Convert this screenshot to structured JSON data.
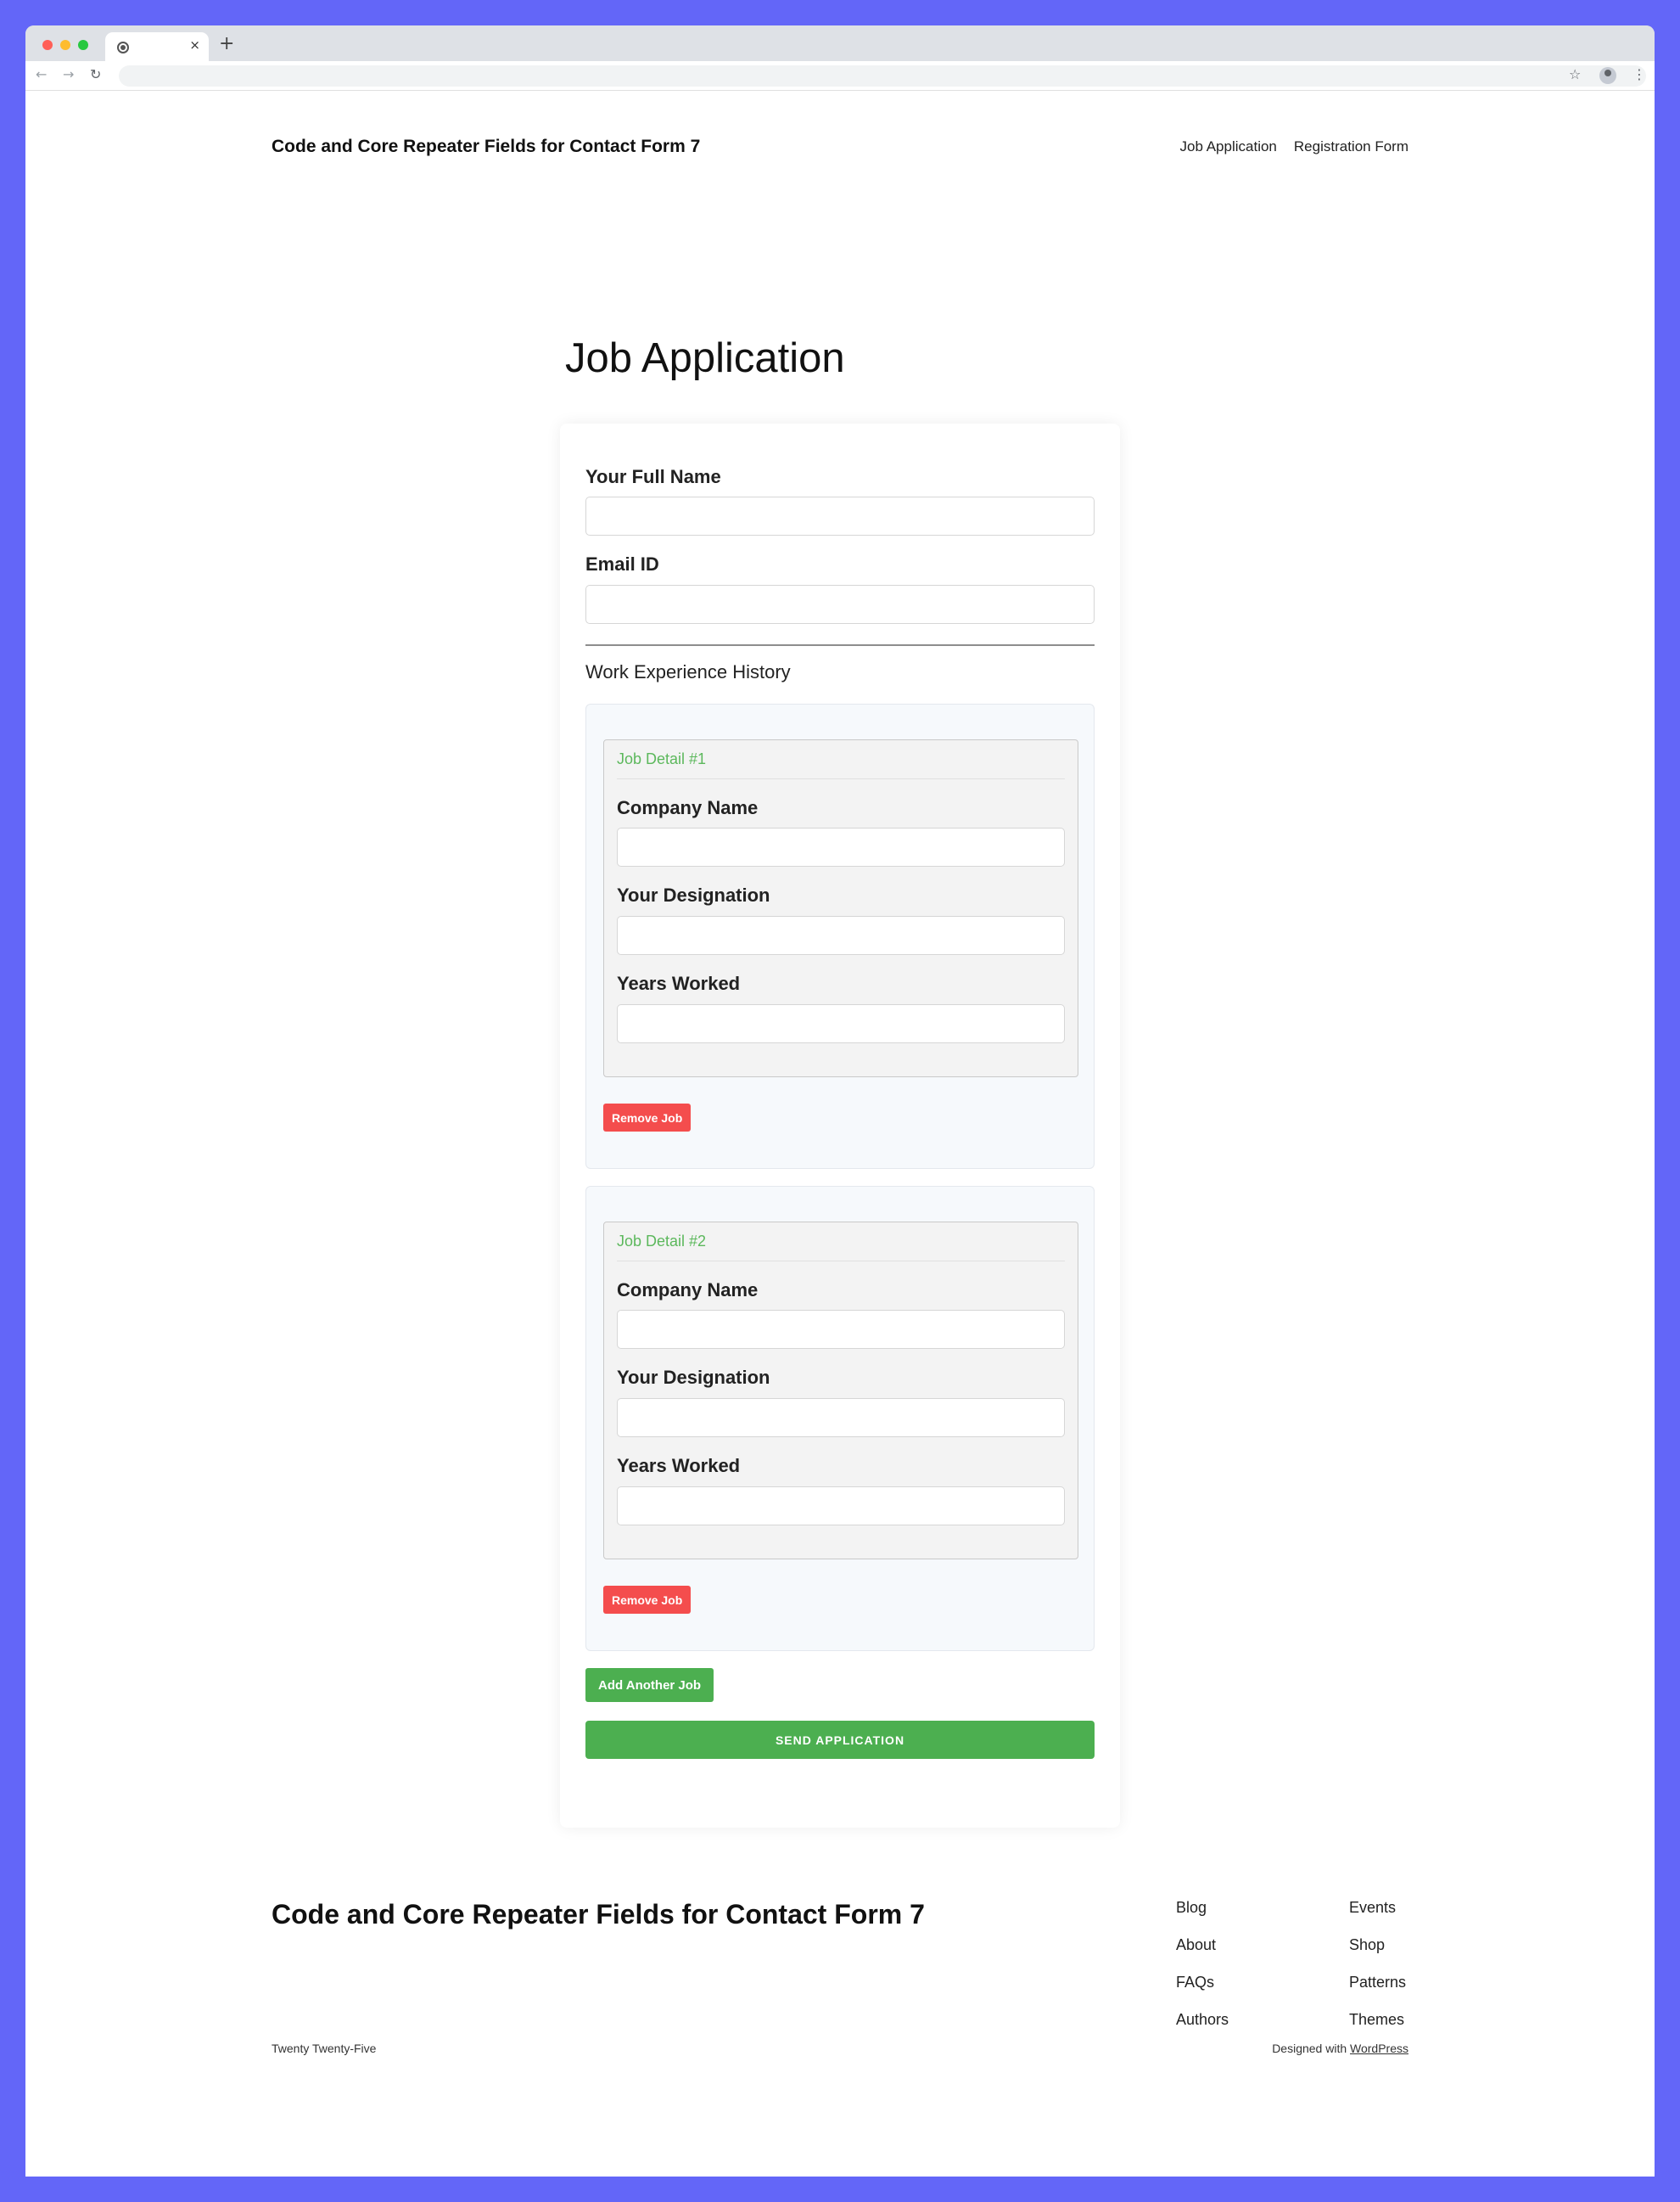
{
  "browser": {
    "tab_close": "×",
    "new_tab": "+"
  },
  "site": {
    "title": "Code and Core Repeater Fields for Contact Form 7",
    "nav": [
      "Job Application",
      "Registration Form"
    ]
  },
  "page": {
    "title": "Job Application"
  },
  "form": {
    "full_name_label": "Your Full Name",
    "full_name_value": "",
    "email_label": "Email ID",
    "email_value": "",
    "section_title": "Work Experience History",
    "jobs": [
      {
        "legend": "Job Detail #1",
        "company_label": "Company Name",
        "company_value": "",
        "designation_label": "Your Designation",
        "designation_value": "",
        "years_label": "Years Worked",
        "years_value": "",
        "remove_label": "Remove Job"
      },
      {
        "legend": "Job Detail #2",
        "company_label": "Company Name",
        "company_value": "",
        "designation_label": "Your Designation",
        "designation_value": "",
        "years_label": "Years Worked",
        "years_value": "",
        "remove_label": "Remove Job"
      }
    ],
    "add_label": "Add Another Job",
    "submit_label": "SEND APPLICATION"
  },
  "footer": {
    "title": "Code and Core Repeater Fields for Contact Form 7",
    "col1": [
      "Blog",
      "About",
      "FAQs",
      "Authors"
    ],
    "col2": [
      "Events",
      "Shop",
      "Patterns",
      "Themes"
    ],
    "theme_name": "Twenty Twenty-Five",
    "designed_with": "Designed with",
    "wordpress": "WordPress"
  },
  "colors": {
    "page_background": "#6366f8",
    "accent_green": "#4caf50",
    "danger_red": "#f44d4d",
    "legend_green": "#5cb85c"
  },
  "icons": [
    "back-arrow-icon",
    "forward-arrow-icon",
    "reload-icon",
    "bookmark-star-icon",
    "profile-icon",
    "kebab-menu-icon",
    "chrome-favicon-icon"
  ]
}
